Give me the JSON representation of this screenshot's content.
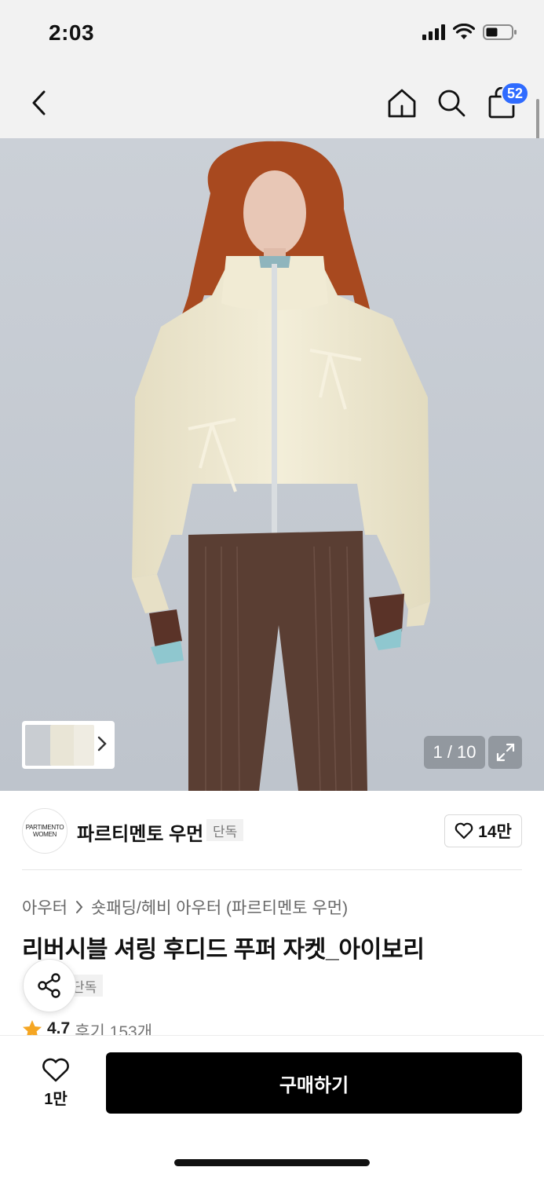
{
  "status_bar": {
    "time": "2:03"
  },
  "nav": {
    "cart_badge": "52"
  },
  "gallery": {
    "counter": "1 / 10",
    "colors": {
      "background": "#c6cbd2",
      "jacket": "#efe9d2",
      "pants": "#5b3f33",
      "hair": "#a64a22"
    }
  },
  "brand": {
    "logo_line1": "PARTIMENTO",
    "logo_line2": "WOMEN",
    "name": "파르티멘토 우먼",
    "tag": "단독",
    "likes": "14만"
  },
  "product": {
    "breadcrumb": [
      "아우터",
      "숏패딩/헤비 아우터 (파르티멘토 우먼)"
    ],
    "title": "리버시블 셔링 후디드 푸퍼 자켓_아이보리",
    "exclusive_tag": "단독",
    "rating": "4.7",
    "reviews": "후기 153개",
    "star_color": "#f5a623"
  },
  "bottom_bar": {
    "wish_count": "1만",
    "buy_label": "구매하기",
    "buy_color": "#000000"
  }
}
